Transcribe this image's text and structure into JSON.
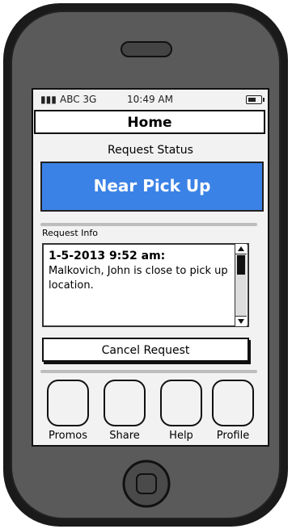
{
  "status_bar": {
    "signal": "▮▮▮",
    "carrier": "ABC 3G",
    "time": "10:49 AM"
  },
  "header": {
    "title": "Home"
  },
  "request_status": {
    "label": "Request Status",
    "value": "Near Pick Up",
    "color": "#3b82e6"
  },
  "request_info": {
    "label": "Request Info",
    "headline": "1-5-2013 9:52 am:",
    "message": "Malkovich, John is close to pick up location."
  },
  "actions": {
    "cancel_label": "Cancel Request"
  },
  "tabs": [
    {
      "label": "Promos"
    },
    {
      "label": "Share"
    },
    {
      "label": "Help"
    },
    {
      "label": "Profile"
    }
  ]
}
